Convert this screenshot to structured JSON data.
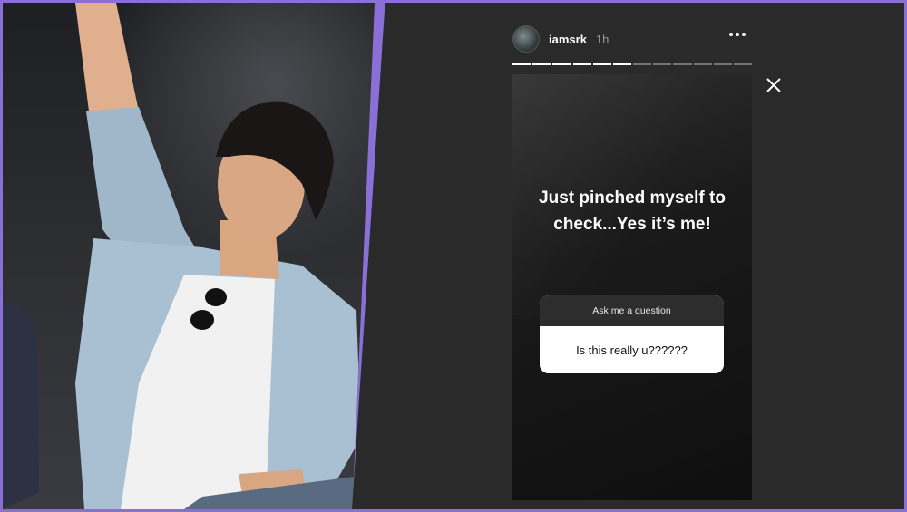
{
  "story": {
    "username": "iamsrk",
    "time_ago": "1h",
    "progress_segments": 12,
    "progress_done": 6,
    "caption_line1": "Just pinched myself to",
    "caption_line2": "check...Yes it’s me!",
    "question_sticker": {
      "prompt": "Ask me a question",
      "answer": "Is this really u??????"
    }
  },
  "icons": {
    "more": "more-horizontal-icon",
    "close": "close-icon"
  },
  "colors": {
    "border": "#8a6fd6",
    "story_background": "#2a2a2a",
    "text": "#ffffff"
  }
}
